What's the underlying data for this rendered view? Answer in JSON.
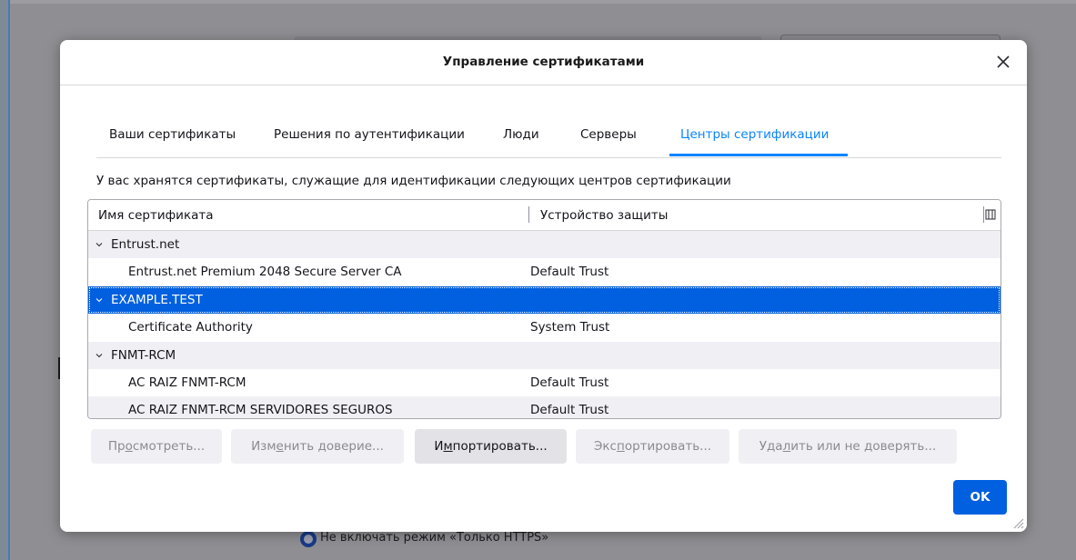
{
  "dialog": {
    "title": "Управление сертификатами",
    "description": "У вас хранятся сертификаты, служащие для идентификации следующих центров сертификации"
  },
  "tabs": [
    {
      "label": "Ваши сертификаты",
      "active": false
    },
    {
      "label": "Решения по аутентификации",
      "active": false
    },
    {
      "label": "Люди",
      "active": false
    },
    {
      "label": "Серверы",
      "active": false
    },
    {
      "label": "Центры сертификации",
      "active": true
    }
  ],
  "table": {
    "columns": [
      "Имя сертификата",
      "Устройство защиты"
    ],
    "rows": [
      {
        "type": "group",
        "name": "Entrust.net",
        "device": ""
      },
      {
        "type": "item",
        "name": "Entrust.net Premium 2048 Secure Server CA",
        "device": "Default Trust"
      },
      {
        "type": "group",
        "name": "EXAMPLE.TEST",
        "device": "",
        "selected": true
      },
      {
        "type": "item",
        "name": "Certificate Authority",
        "device": "System Trust"
      },
      {
        "type": "group",
        "name": "FNMT-RCM",
        "device": ""
      },
      {
        "type": "item",
        "name": "AC RAIZ FNMT-RCM",
        "device": "Default Trust"
      },
      {
        "type": "item",
        "name": "AC RAIZ FNMT-RCM SERVIDORES SEGUROS",
        "device": "Default Trust"
      }
    ]
  },
  "buttons": {
    "view": {
      "before": "Пр",
      "key": "о",
      "after": "смотреть..."
    },
    "edit_trust": {
      "before": "Изм",
      "key": "е",
      "after": "нить доверие..."
    },
    "import": {
      "before": "И",
      "key": "м",
      "after": "портировать..."
    },
    "export": {
      "before": "Экс",
      "key": "п",
      "after": "ортировать..."
    },
    "delete": {
      "before": "Уда",
      "key": "л",
      "after": "ить или не доверять..."
    },
    "ok": "OK"
  },
  "background": {
    "radio_label": "Не включать режим «Только HTTPS»"
  },
  "colors": {
    "accent": "#0a84ff",
    "selection": "#0060df",
    "primary_button": "#0060df"
  }
}
